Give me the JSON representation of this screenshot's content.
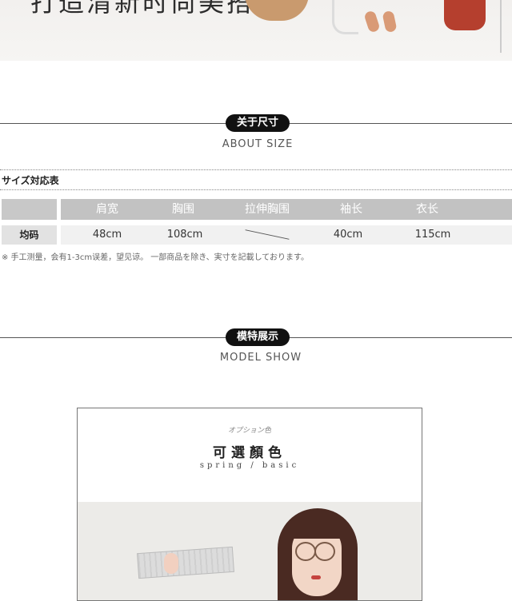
{
  "banner": {
    "text": "打造清新时尚美搭"
  },
  "about_size": {
    "heading": "关于尺寸",
    "subheading": "ABOUT SIZE",
    "table_title": "サイズ対応表",
    "columns": [
      "肩宽",
      "胸围",
      "拉伸胸围",
      "袖长",
      "衣长"
    ],
    "row_label": "均码",
    "values": [
      "48cm",
      "108cm",
      "",
      "40cm",
      "115cm"
    ],
    "note": "※ 手工测量，会有1-3cm误差，望见谅。 一部商品を除き、実寸を記載しております。"
  },
  "model_show": {
    "heading": "模特展示",
    "subheading": "MODEL SHOW",
    "card": {
      "small_text": "オプション色",
      "title": "可選顏色",
      "subtitle": "spring / basic"
    }
  },
  "colors": {
    "pill": "#111111",
    "header_gray": "#c2c2c2",
    "row_gray": "#f1f1f1"
  }
}
